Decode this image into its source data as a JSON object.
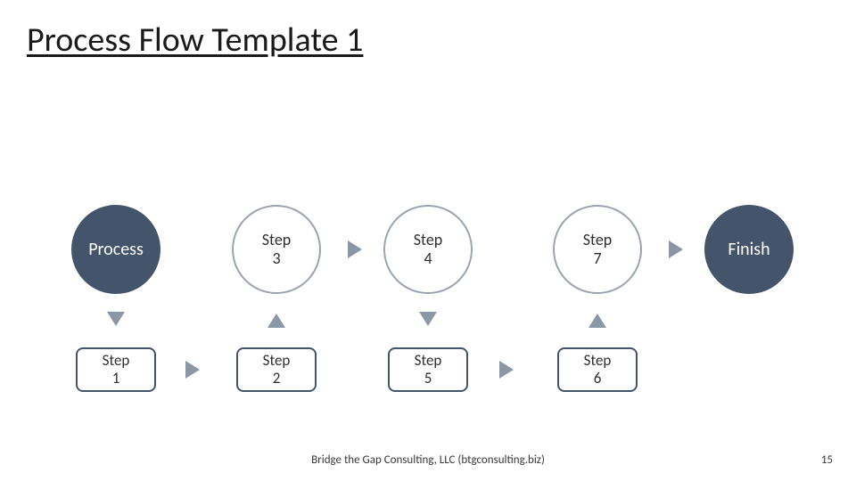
{
  "title": "Process Flow Template 1",
  "footer": "Bridge the Gap Consulting, LLC (btgconsulting.biz)",
  "page_number": "15",
  "nodes": {
    "process": "Process",
    "step1": "Step\n1",
    "step2": "Step\n2",
    "step3": "Step\n3",
    "step4": "Step\n4",
    "step5": "Step\n5",
    "step6": "Step\n6",
    "step7": "Step\n7",
    "finish": "Finish"
  },
  "colors": {
    "dark": "#44546a",
    "arrow": "#8b97a5"
  },
  "chart_data": {
    "type": "diagram",
    "title": "Process Flow Template 1",
    "nodes": [
      {
        "id": "process",
        "label": "Process",
        "row": 0,
        "col": 0,
        "style": "start"
      },
      {
        "id": "step3",
        "label": "Step 3",
        "row": 0,
        "col": 1,
        "style": "mid-top"
      },
      {
        "id": "step4",
        "label": "Step 4",
        "row": 0,
        "col": 2,
        "style": "mid-top"
      },
      {
        "id": "step7",
        "label": "Step 7",
        "row": 0,
        "col": 3,
        "style": "mid-top"
      },
      {
        "id": "finish",
        "label": "Finish",
        "row": 0,
        "col": 4,
        "style": "finish"
      },
      {
        "id": "step1",
        "label": "Step 1",
        "row": 1,
        "col": 0,
        "style": "mid-bot"
      },
      {
        "id": "step2",
        "label": "Step 2",
        "row": 1,
        "col": 1,
        "style": "mid-bot"
      },
      {
        "id": "step5",
        "label": "Step 5",
        "row": 1,
        "col": 2,
        "style": "mid-bot"
      },
      {
        "id": "step6",
        "label": "Step 6",
        "row": 1,
        "col": 3,
        "style": "mid-bot"
      }
    ],
    "edges": [
      {
        "from": "process",
        "to": "step1",
        "dir": "down"
      },
      {
        "from": "step1",
        "to": "step2",
        "dir": "right"
      },
      {
        "from": "step2",
        "to": "step3",
        "dir": "up"
      },
      {
        "from": "step3",
        "to": "step4",
        "dir": "right"
      },
      {
        "from": "step4",
        "to": "step5",
        "dir": "down"
      },
      {
        "from": "step5",
        "to": "step6",
        "dir": "right"
      },
      {
        "from": "step6",
        "to": "step7",
        "dir": "up"
      },
      {
        "from": "step7",
        "to": "finish",
        "dir": "right"
      }
    ]
  }
}
